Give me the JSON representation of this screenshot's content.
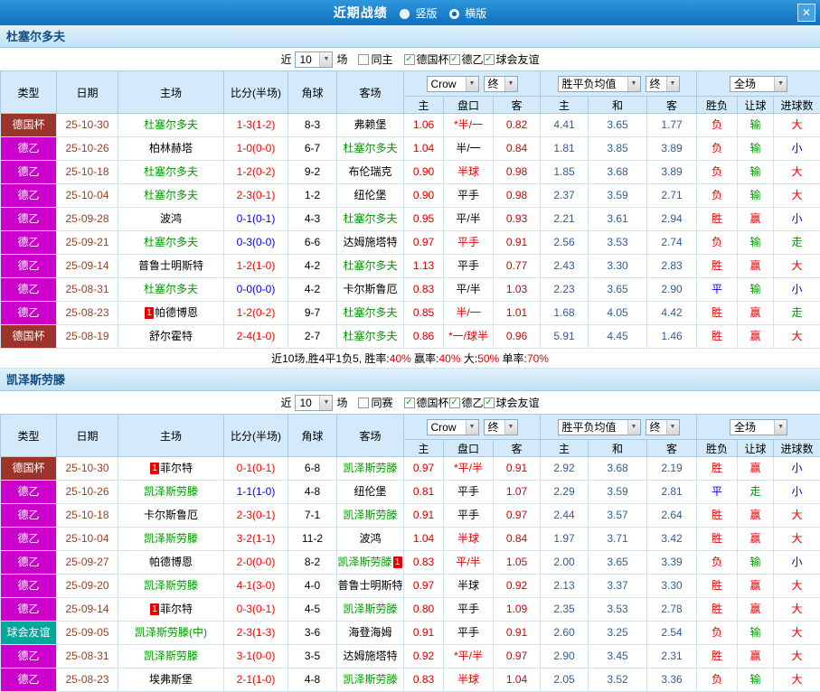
{
  "titlebar": {
    "title": "近期战绩",
    "vertical_label": "竖版",
    "horizontal_label": "横版",
    "selected_layout": "横版"
  },
  "icons": {
    "arrow": "▼",
    "check": "✓",
    "close": "✕"
  },
  "filters": {
    "near_label": "近",
    "count": "10",
    "games_label": "场",
    "leagues": [
      "德国杯",
      "德乙",
      "球会友谊"
    ]
  },
  "dropdowns": {
    "odds_source": "Crow",
    "final": "终",
    "avg": "胜平负均值",
    "scope": "全场"
  },
  "columns": {
    "type": "类型",
    "date": "日期",
    "home": "主场",
    "score": "比分(半场)",
    "corner": "角球",
    "away": "客场",
    "odds_home": "主",
    "handicap": "盘口",
    "odds_away": "客",
    "avg_home": "主",
    "avg_draw": "和",
    "avg_away": "客",
    "result": "胜负",
    "handicap_result": "让球",
    "goals": "进球数"
  },
  "colors": {
    "titlebar_blue": "#1779c4",
    "section_header_bg": "#cde7f8",
    "table_header_bg": "#d4eafa",
    "league_cup": "#9c342c",
    "league_d2": "#cc00cc",
    "league_friendly": "#00a79b",
    "featured_team_green": "#009900",
    "score_red": "#ff0000",
    "score_blue": "#0000ff",
    "odds_red": "#d40000",
    "avg_blue": "#335c95",
    "date_brown": "#994022",
    "flag_red": "#e60000",
    "flag_blue": "#0000e6",
    "flag_green": "#009900"
  },
  "tables": [
    {
      "team": "杜塞尔多夫",
      "same_filter_label": "同主",
      "rows": [
        {
          "league": "德国杯",
          "league_class": "cup",
          "date": "25-10-30",
          "home": "杜塞尔多夫",
          "home_feat": true,
          "score": "1-3(1-2)",
          "score_class": "red",
          "corner": "8-3",
          "away": "弗赖堡",
          "odds_home": "1.06",
          "handicap": "*半/一",
          "handicap_red": true,
          "odds_away": "0.82",
          "avg_home": "4.41",
          "avg_draw": "3.65",
          "avg_away": "1.77",
          "result": "负",
          "result_class": "red",
          "handicap_result": "输",
          "handicap_result_class": "green",
          "goals": "大",
          "goals_class": "red"
        },
        {
          "league": "德乙",
          "league_class": "d2",
          "date": "25-10-26",
          "home": "柏林赫塔",
          "score": "1-0(0-0)",
          "score_class": "red",
          "corner": "6-7",
          "away": "杜塞尔多夫",
          "away_feat": true,
          "odds_home": "1.04",
          "handicap": "半/一",
          "odds_away": "0.84",
          "avg_home": "1.81",
          "avg_draw": "3.85",
          "avg_away": "3.89",
          "result": "负",
          "result_class": "red",
          "handicap_result": "输",
          "handicap_result_class": "green",
          "goals": "小",
          "goals_class": "blue"
        },
        {
          "league": "德乙",
          "league_class": "d2",
          "date": "25-10-18",
          "home": "杜塞尔多夫",
          "home_feat": true,
          "score": "1-2(0-2)",
          "score_class": "red",
          "corner": "9-2",
          "away": "布伦瑞克",
          "odds_home": "0.90",
          "handicap": "半球",
          "handicap_red": true,
          "odds_away": "0.98",
          "avg_home": "1.85",
          "avg_draw": "3.68",
          "avg_away": "3.89",
          "result": "负",
          "result_class": "red",
          "handicap_result": "输",
          "handicap_result_class": "green",
          "goals": "大",
          "goals_class": "red"
        },
        {
          "league": "德乙",
          "league_class": "d2",
          "date": "25-10-04",
          "home": "杜塞尔多夫",
          "home_feat": true,
          "score": "2-3(0-1)",
          "score_class": "red",
          "corner": "1-2",
          "away": "纽伦堡",
          "odds_home": "0.90",
          "handicap": "平手",
          "odds_away": "0.98",
          "avg_home": "2.37",
          "avg_draw": "3.59",
          "avg_away": "2.71",
          "result": "负",
          "result_class": "red",
          "handicap_result": "输",
          "handicap_result_class": "green",
          "goals": "大",
          "goals_class": "red"
        },
        {
          "league": "德乙",
          "league_class": "d2",
          "date": "25-09-28",
          "home": "波鸿",
          "score": "0-1(0-1)",
          "score_class": "blue",
          "corner": "4-3",
          "away": "杜塞尔多夫",
          "away_feat": true,
          "odds_home": "0.95",
          "handicap": "平/半",
          "odds_away": "0.93",
          "avg_home": "2.21",
          "avg_draw": "3.61",
          "avg_away": "2.94",
          "result": "胜",
          "result_class": "red",
          "handicap_result": "赢",
          "handicap_result_class": "red",
          "goals": "小",
          "goals_class": "blue"
        },
        {
          "league": "德乙",
          "league_class": "d2",
          "date": "25-09-21",
          "home": "杜塞尔多夫",
          "home_feat": true,
          "score": "0-3(0-0)",
          "score_class": "blue",
          "corner": "6-6",
          "away": "达姆施塔特",
          "odds_home": "0.97",
          "handicap": "平手",
          "handicap_red": true,
          "odds_away": "0.91",
          "avg_home": "2.56",
          "avg_draw": "3.53",
          "avg_away": "2.74",
          "result": "负",
          "result_class": "red",
          "handicap_result": "输",
          "handicap_result_class": "green",
          "goals": "走",
          "goals_class": "green"
        },
        {
          "league": "德乙",
          "league_class": "d2",
          "date": "25-09-14",
          "home": "普鲁士明斯特",
          "score": "1-2(1-0)",
          "score_class": "red",
          "corner": "4-2",
          "away": "杜塞尔多夫",
          "away_feat": true,
          "odds_home": "1.13",
          "handicap": "平手",
          "odds_away": "0.77",
          "avg_home": "2.43",
          "avg_draw": "3.30",
          "avg_away": "2.83",
          "result": "胜",
          "result_class": "red",
          "handicap_result": "赢",
          "handicap_result_class": "red",
          "goals": "大",
          "goals_class": "red"
        },
        {
          "league": "德乙",
          "league_class": "d2",
          "date": "25-08-31",
          "home": "杜塞尔多夫",
          "home_feat": true,
          "score": "0-0(0-0)",
          "score_class": "blue",
          "corner": "4-2",
          "away": "卡尔斯鲁厄",
          "odds_home": "0.83",
          "handicap": "平/半",
          "odds_away": "1.03",
          "avg_home": "2.23",
          "avg_draw": "3.65",
          "avg_away": "2.90",
          "result": "平",
          "result_class": "blue",
          "handicap_result": "输",
          "handicap_result_class": "green",
          "goals": "小",
          "goals_class": "blue"
        },
        {
          "league": "德乙",
          "league_class": "d2",
          "date": "25-08-23",
          "home": "帕德博恩",
          "home_card": "1",
          "score": "1-2(0-2)",
          "score_class": "red",
          "corner": "9-7",
          "away": "杜塞尔多夫",
          "away_feat": true,
          "odds_home": "0.85",
          "handicap": "半/一",
          "handicap_red": true,
          "odds_away": "1.01",
          "avg_home": "1.68",
          "avg_draw": "4.05",
          "avg_away": "4.42",
          "result": "胜",
          "result_class": "red",
          "handicap_result": "赢",
          "handicap_result_class": "red",
          "goals": "走",
          "goals_class": "green"
        },
        {
          "league": "德国杯",
          "league_class": "cup",
          "date": "25-08-19",
          "home": "舒尔霍特",
          "score": "2-4(1-0)",
          "score_class": "red",
          "corner": "2-7",
          "away": "杜塞尔多夫",
          "away_feat": true,
          "odds_home": "0.86",
          "handicap": "*一/球半",
          "handicap_red": true,
          "odds_away": "0.96",
          "avg_home": "5.91",
          "avg_draw": "4.45",
          "avg_away": "1.46",
          "result": "胜",
          "result_class": "red",
          "handicap_result": "赢",
          "handicap_result_class": "red",
          "goals": "大",
          "goals_class": "red"
        }
      ],
      "summary": [
        {
          "text": "近10场,胜4平1负5, 胜率:",
          "red": false
        },
        {
          "text": "40%",
          "red": true
        },
        {
          "text": "  赢率:",
          "red": false
        },
        {
          "text": "40%",
          "red": true
        },
        {
          "text": "  大:",
          "red": false
        },
        {
          "text": "50%",
          "red": true
        },
        {
          "text": "  单率:",
          "red": false
        },
        {
          "text": "70%",
          "red": true
        }
      ]
    },
    {
      "team": "凯泽斯劳滕",
      "same_filter_label": "同赛",
      "rows": [
        {
          "league": "德国杯",
          "league_class": "cup",
          "date": "25-10-30",
          "home": "菲尔特",
          "home_card": "1",
          "score": "0-1(0-1)",
          "score_class": "red",
          "corner": "6-8",
          "away": "凯泽斯劳滕",
          "away_feat": true,
          "odds_home": "0.97",
          "handicap": "*平/半",
          "handicap_red": true,
          "odds_away": "0.91",
          "avg_home": "2.92",
          "avg_draw": "3.68",
          "avg_away": "2.19",
          "result": "胜",
          "result_class": "red",
          "handicap_result": "赢",
          "handicap_result_class": "red",
          "goals": "小",
          "goals_class": "blue"
        },
        {
          "league": "德乙",
          "league_class": "d2",
          "date": "25-10-26",
          "home": "凯泽斯劳滕",
          "home_feat": true,
          "score": "1-1(1-0)",
          "score_class": "blue",
          "corner": "4-8",
          "away": "纽伦堡",
          "odds_home": "0.81",
          "handicap": "平手",
          "odds_away": "1.07",
          "avg_home": "2.29",
          "avg_draw": "3.59",
          "avg_away": "2.81",
          "result": "平",
          "result_class": "blue",
          "handicap_result": "走",
          "handicap_result_class": "green",
          "goals": "小",
          "goals_class": "blue"
        },
        {
          "league": "德乙",
          "league_class": "d2",
          "date": "25-10-18",
          "home": "卡尔斯鲁厄",
          "score": "2-3(0-1)",
          "score_class": "red",
          "corner": "7-1",
          "away": "凯泽斯劳滕",
          "away_feat": true,
          "odds_home": "0.91",
          "handicap": "平手",
          "odds_away": "0.97",
          "avg_home": "2.44",
          "avg_draw": "3.57",
          "avg_away": "2.64",
          "result": "胜",
          "result_class": "red",
          "handicap_result": "赢",
          "handicap_result_class": "red",
          "goals": "大",
          "goals_class": "red"
        },
        {
          "league": "德乙",
          "league_class": "d2",
          "date": "25-10-04",
          "home": "凯泽斯劳滕",
          "home_feat": true,
          "score": "3-2(1-1)",
          "score_class": "red",
          "corner": "11-2",
          "away": "波鸿",
          "odds_home": "1.04",
          "handicap": "半球",
          "handicap_red": true,
          "odds_away": "0.84",
          "avg_home": "1.97",
          "avg_draw": "3.71",
          "avg_away": "3.42",
          "result": "胜",
          "result_class": "red",
          "handicap_result": "赢",
          "handicap_result_class": "red",
          "goals": "大",
          "goals_class": "red"
        },
        {
          "league": "德乙",
          "league_class": "d2",
          "date": "25-09-27",
          "home": "帕德博恩",
          "score": "2-0(0-0)",
          "score_class": "red",
          "corner": "8-2",
          "away": "凯泽斯劳滕",
          "away_feat": true,
          "away_card": "1",
          "away_card_after": true,
          "odds_home": "0.83",
          "handicap": "平/半",
          "handicap_red": true,
          "odds_away": "1.05",
          "avg_home": "2.00",
          "avg_draw": "3.65",
          "avg_away": "3.39",
          "result": "负",
          "result_class": "red",
          "handicap_result": "输",
          "handicap_result_class": "green",
          "goals": "小",
          "goals_class": "blue"
        },
        {
          "league": "德乙",
          "league_class": "d2",
          "date": "25-09-20",
          "home": "凯泽斯劳滕",
          "home_feat": true,
          "score": "4-1(3-0)",
          "score_class": "red",
          "corner": "4-0",
          "away": "普鲁士明斯特",
          "odds_home": "0.97",
          "handicap": "半球",
          "odds_away": "0.92",
          "avg_home": "2.13",
          "avg_draw": "3.37",
          "avg_away": "3.30",
          "result": "胜",
          "result_class": "red",
          "handicap_result": "赢",
          "handicap_result_class": "red",
          "goals": "大",
          "goals_class": "red"
        },
        {
          "league": "德乙",
          "league_class": "d2",
          "date": "25-09-14",
          "home": "菲尔特",
          "home_card": "1",
          "score": "0-3(0-1)",
          "score_class": "red",
          "corner": "4-5",
          "away": "凯泽斯劳滕",
          "away_feat": true,
          "odds_home": "0.80",
          "handicap": "平手",
          "odds_away": "1.09",
          "avg_home": "2.35",
          "avg_draw": "3.53",
          "avg_away": "2.78",
          "result": "胜",
          "result_class": "red",
          "handicap_result": "赢",
          "handicap_result_class": "red",
          "goals": "大",
          "goals_class": "red"
        },
        {
          "league": "球会友谊",
          "league_class": "friendly",
          "date": "25-09-05",
          "home": "凯泽斯劳滕(中)",
          "home_feat": true,
          "score": "2-3(1-3)",
          "score_class": "red",
          "corner": "3-6",
          "away": "海登海姆",
          "odds_home": "0.91",
          "handicap": "平手",
          "odds_away": "0.91",
          "avg_home": "2.60",
          "avg_draw": "3.25",
          "avg_away": "2.54",
          "result": "负",
          "result_class": "red",
          "handicap_result": "输",
          "handicap_result_class": "green",
          "goals": "大",
          "goals_class": "red"
        },
        {
          "league": "德乙",
          "league_class": "d2",
          "date": "25-08-31",
          "home": "凯泽斯劳滕",
          "home_feat": true,
          "score": "3-1(0-0)",
          "score_class": "red",
          "corner": "3-5",
          "away": "达姆施塔特",
          "odds_home": "0.92",
          "handicap": "*平/半",
          "handicap_red": true,
          "odds_away": "0.97",
          "avg_home": "2.90",
          "avg_draw": "3.45",
          "avg_away": "2.31",
          "result": "胜",
          "result_class": "red",
          "handicap_result": "赢",
          "handicap_result_class": "red",
          "goals": "大",
          "goals_class": "red"
        },
        {
          "league": "德乙",
          "league_class": "d2",
          "date": "25-08-23",
          "home": "埃弗斯堡",
          "score": "2-1(1-0)",
          "score_class": "red",
          "corner": "4-8",
          "away": "凯泽斯劳滕",
          "away_feat": true,
          "odds_home": "0.83",
          "handicap": "半球",
          "handicap_red": true,
          "odds_away": "1.04",
          "avg_home": "2.05",
          "avg_draw": "3.52",
          "avg_away": "3.36",
          "result": "负",
          "result_class": "red",
          "handicap_result": "输",
          "handicap_result_class": "green",
          "goals": "大",
          "goals_class": "red"
        }
      ]
    }
  ]
}
